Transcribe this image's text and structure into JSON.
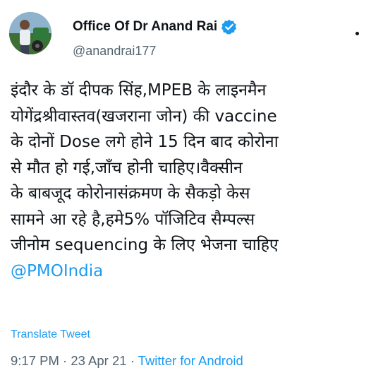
{
  "author": {
    "display_name": "Office Of Dr Anand Rai",
    "handle": "@anandrai177",
    "verified": true
  },
  "tweet": {
    "lines": [
      "इंदौर के डॉ दीपक सिंह,MPEB के लाइनमैन",
      "योगेंद्रश्रीवास्तव(खजराना जोन) की vaccine",
      "के दोनों Dose लगे होने 15 दिन बाद कोरोना",
      "से मौत हो गई,जाँच होनी चाहिए।वैक्सीन",
      "के बाबजूद कोरोनासंक्रमण के सैकड़ो केस",
      "सामने आ रहे है,हमे5% पॉजिटिव सैम्पल्स",
      "जीनोम sequencing के लिए भेजना चाहिए"
    ],
    "mention": "@PMOIndia",
    "translate_label": "Translate Tweet",
    "time": "9:17 PM",
    "date": "23 Apr 21",
    "separator": " · ",
    "source": "Twitter for Android"
  },
  "colors": {
    "link": "#1d9bf0",
    "secondary_text": "#536471",
    "primary_text": "#0f1419"
  },
  "icons": {
    "verified": "verified-badge-icon",
    "more": "more-options-icon"
  }
}
